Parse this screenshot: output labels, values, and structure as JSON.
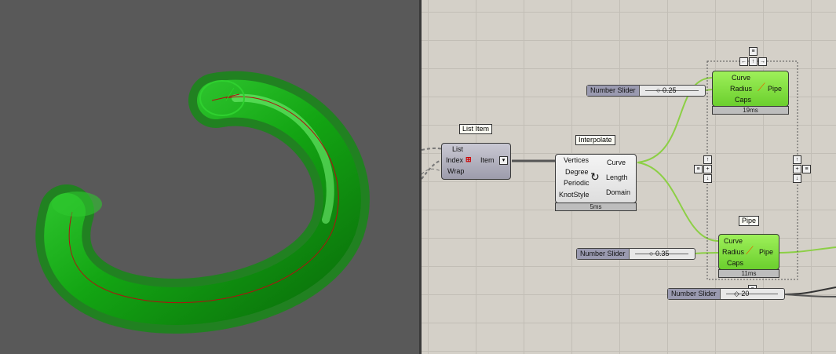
{
  "viewport": {
    "background": "#595959",
    "object_color": "#1fb81f"
  },
  "list_item": {
    "tag": "List Item",
    "inputs": [
      "List",
      "Index",
      "Wrap"
    ],
    "output": "Item"
  },
  "interpolate": {
    "tag": "Interpolate",
    "inputs": [
      "Vertices",
      "Degree",
      "Periodic",
      "KnotStyle"
    ],
    "outputs": [
      "Curve",
      "Length",
      "Domain"
    ],
    "timing": "5ms"
  },
  "pipe_top": {
    "inputs": [
      "Curve",
      "Radius",
      "Caps"
    ],
    "output": "Pipe",
    "timing": "19ms"
  },
  "pipe_bottom": {
    "tag": "Pipe",
    "inputs": [
      "Curve",
      "Radius",
      "Caps"
    ],
    "output": "Pipe",
    "timing": "11ms"
  },
  "sliders": [
    {
      "name": "Number Slider",
      "value": "0.25"
    },
    {
      "name": "Number Slider",
      "value": "0.35"
    },
    {
      "name": "Number Slider",
      "value": "20"
    }
  ],
  "colors": {
    "canvas": "#d4d0c8",
    "wire_green": "#8ccf45",
    "component_green": "#8ee64c",
    "component_gray": "#b0afbd"
  }
}
